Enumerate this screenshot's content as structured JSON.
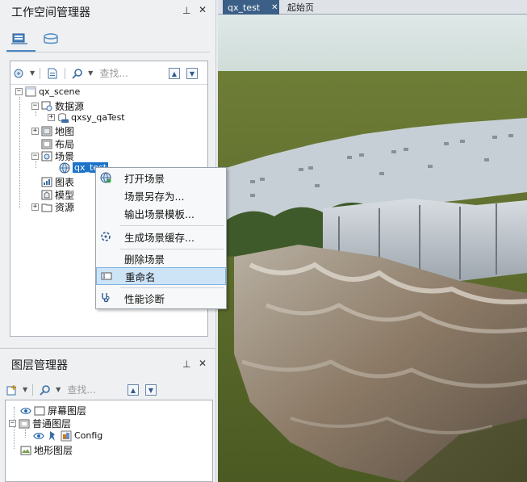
{
  "workspace_panel": {
    "title": "工作空间管理器",
    "pin_glyph": "⊥",
    "close_glyph": "✕",
    "search_placeholder": "查找...",
    "tree": {
      "root": "qx_scene",
      "datasources": "数据源",
      "datasource_item": "qxsy_qaTest",
      "maps": "地图",
      "layouts": "布局",
      "scenes": "场景",
      "scene_item": "qx_test",
      "charts": "图表",
      "models": "模型",
      "resources": "资源"
    }
  },
  "context_menu": {
    "items": [
      {
        "label": "打开场景",
        "icon": "globe-open-icon"
      },
      {
        "label": "场景另存为...",
        "icon": ""
      },
      {
        "label": "输出场景模板...",
        "icon": ""
      },
      {
        "label": "生成场景缓存...",
        "icon": "cache-icon"
      },
      {
        "label": "删除场景",
        "icon": ""
      },
      {
        "label": "重命名",
        "icon": "rename-icon"
      },
      {
        "label": "性能诊断",
        "icon": "stethoscope-icon"
      }
    ]
  },
  "layer_panel": {
    "title": "图层管理器",
    "pin_glyph": "⊥",
    "close_glyph": "✕",
    "search_placeholder": "查找...",
    "tree": {
      "screen_layers": "屏幕图层",
      "normal_layers": "普通图层",
      "config_item": "Config",
      "terrain_layers": "地形图层"
    }
  },
  "tabs": [
    {
      "label": "qx_test",
      "close_glyph": "✕",
      "active": true
    },
    {
      "label": "起始页",
      "active": false
    }
  ],
  "colors": {
    "selection": "#1c73c9",
    "menu_highlight": "#cde4f7",
    "sky": "#d9e6e3",
    "ground": "#5a6b2a"
  }
}
